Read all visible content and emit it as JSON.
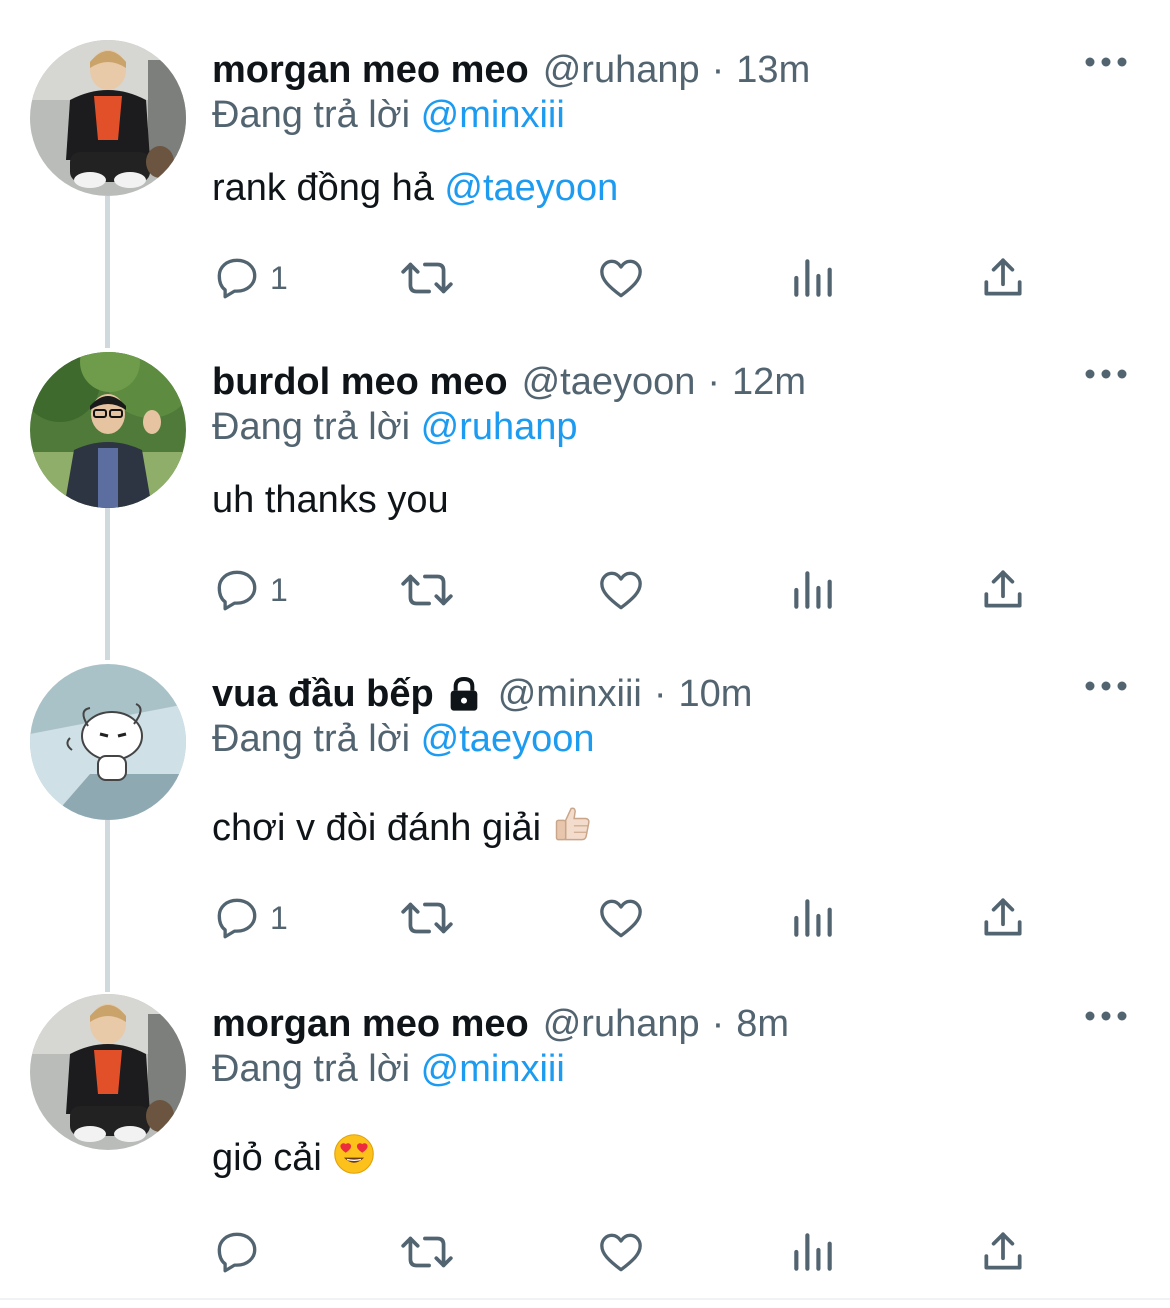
{
  "reply_prefix": "Đang trả lời",
  "colors": {
    "accent": "#1d9bf0",
    "secondary_text": "#536471",
    "primary_text": "#0f1419",
    "thread_line": "#cfd9de"
  },
  "tweets": [
    {
      "display_name": "morgan meo meo",
      "handle": "@ruhanp",
      "separator": "·",
      "time": "13m",
      "reply_to": "@minxiii",
      "text": "rank đồng hả ",
      "text_mention": "@taeyoon",
      "emoji": "",
      "reply_count": "1",
      "locked": false
    },
    {
      "display_name": "burdol meo meo",
      "handle": "@taeyoon",
      "separator": "·",
      "time": "12m",
      "reply_to": "@ruhanp",
      "text": "uh thanks you",
      "text_mention": "",
      "emoji": "",
      "reply_count": "1",
      "locked": false
    },
    {
      "display_name": "vua đầu bếp",
      "handle": "@minxiii",
      "separator": "·",
      "time": "10m",
      "reply_to": "@taeyoon",
      "text": "chơi v đòi đánh giải",
      "text_mention": "",
      "emoji": "thumbs-up-light-skin",
      "reply_count": "1",
      "locked": true
    },
    {
      "display_name": "morgan meo meo",
      "handle": "@ruhanp",
      "separator": "·",
      "time": "8m",
      "reply_to": "@minxiii",
      "text": "giỏ cải",
      "text_mention": "",
      "emoji": "smiling-face-with-heart-eyes",
      "reply_count": "",
      "locked": false
    }
  ]
}
